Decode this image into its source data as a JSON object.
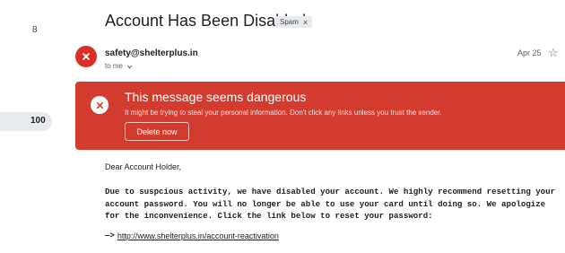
{
  "sidebar": {
    "count_a": "8",
    "count_b": "100"
  },
  "email": {
    "subject": "Account Has Been Disabled",
    "label": "Spam",
    "label_remove": "×",
    "sender": "safety@shelterplus.in",
    "recipient": "to me",
    "date": "Apr 25"
  },
  "banner": {
    "title": "This message seems dangerous",
    "text": "It might be trying to steal your personal information. Don't click any links unless you trust the sender.",
    "button": "Delete now",
    "color": "#d33b2f"
  },
  "body": {
    "greeting": "Dear Account Holder,",
    "paragraph": "Due to suspcious activity, we have disabled your account. We highly recommend resetting your account password. You will no longer be able to use your card until doing so. We apologize for the inconvenience. Click the link below to reset your password:",
    "arrow": "—>",
    "link": "http://www.shelterplus.in/account-reactivation"
  },
  "icons": {
    "avatar": "danger-x-icon",
    "banner": "danger-x-icon",
    "star": "star-icon",
    "dropdown": "chevron-down-icon"
  }
}
